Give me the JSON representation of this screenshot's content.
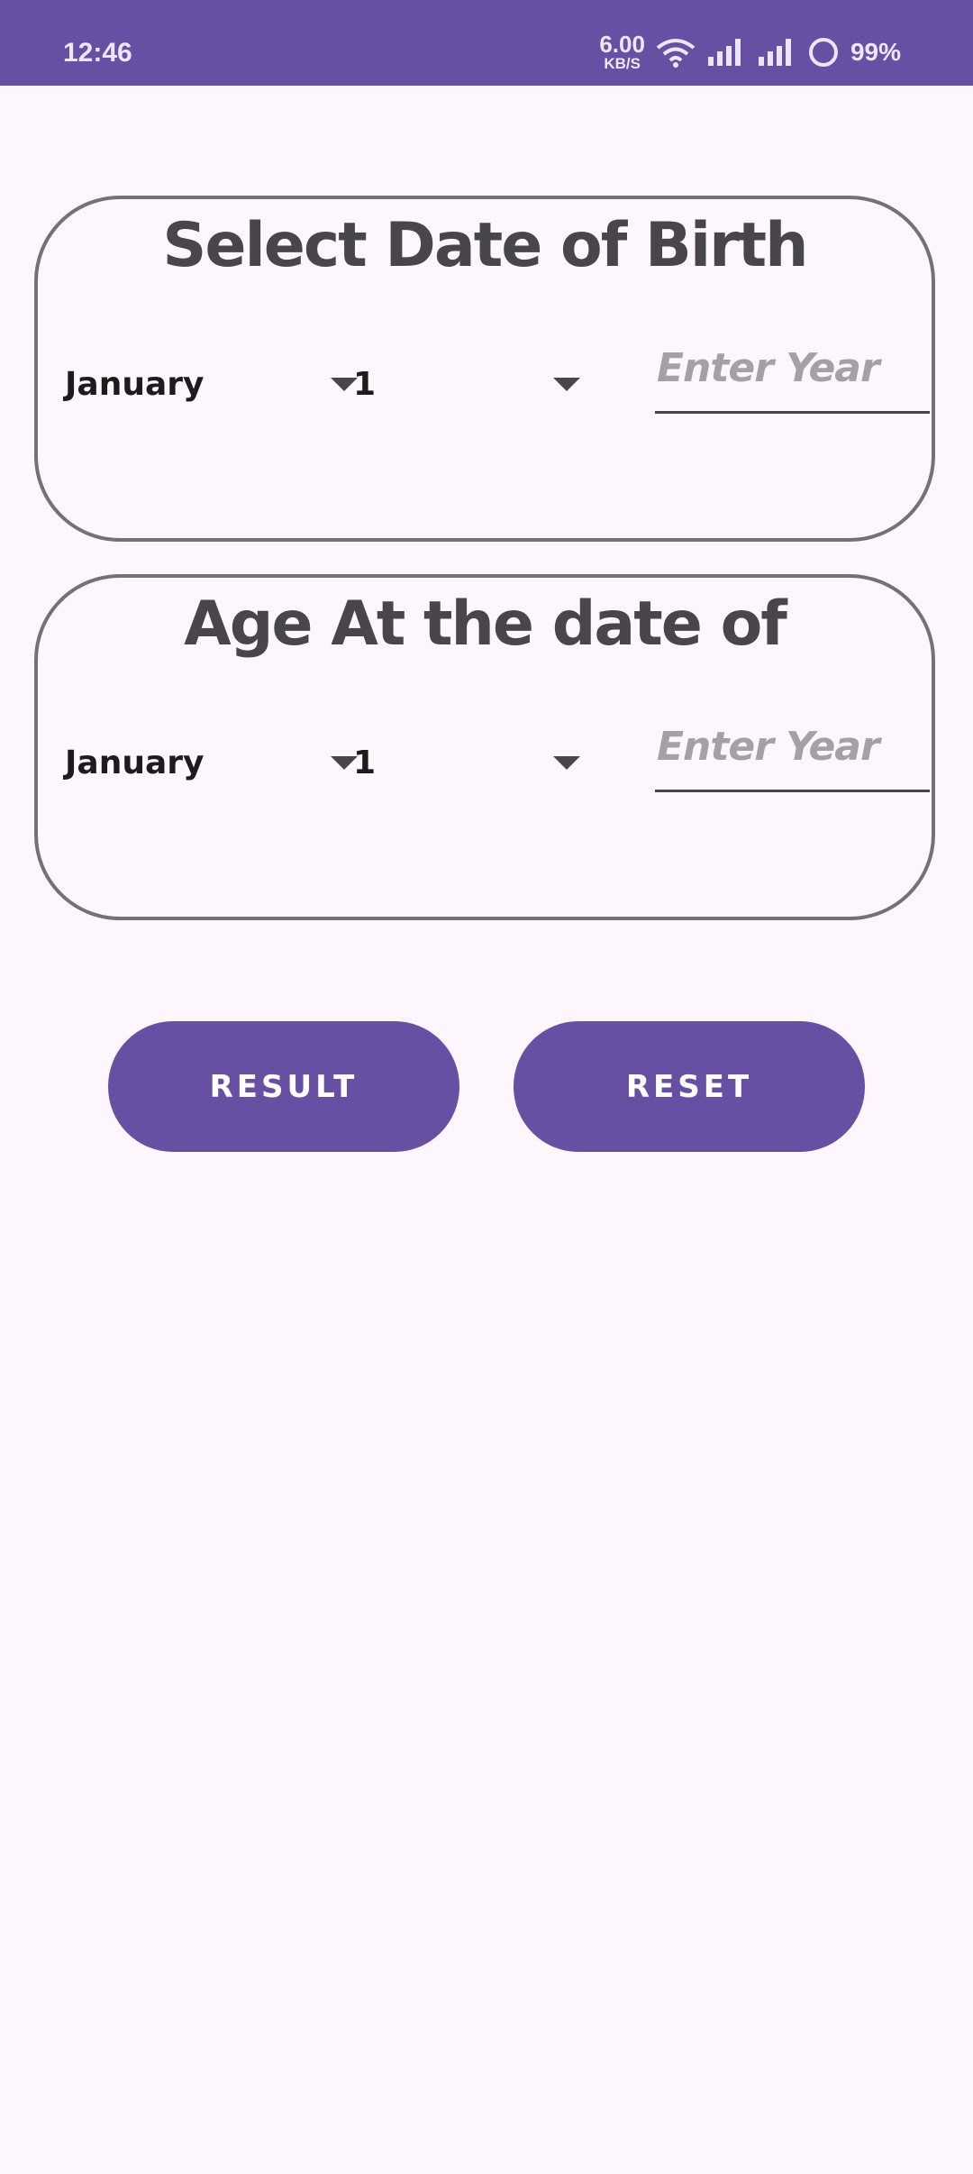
{
  "status_bar": {
    "time": "12:46",
    "net_speed_value": "6.00",
    "net_speed_unit": "KB/S",
    "battery": "99%",
    "color": "#6750a4"
  },
  "dob_card": {
    "title": "Select Date of Birth",
    "month": "January",
    "day": "1",
    "year_placeholder": "Enter Year"
  },
  "age_card": {
    "title": "Age At the date of",
    "month": "January",
    "day": "1",
    "year_placeholder": "Enter Year"
  },
  "actions": {
    "result_label": "RESULT",
    "reset_label": "RESET"
  },
  "colors": {
    "accent": "#6750a4",
    "background": "#fdf7fd",
    "card_border": "#767076"
  }
}
